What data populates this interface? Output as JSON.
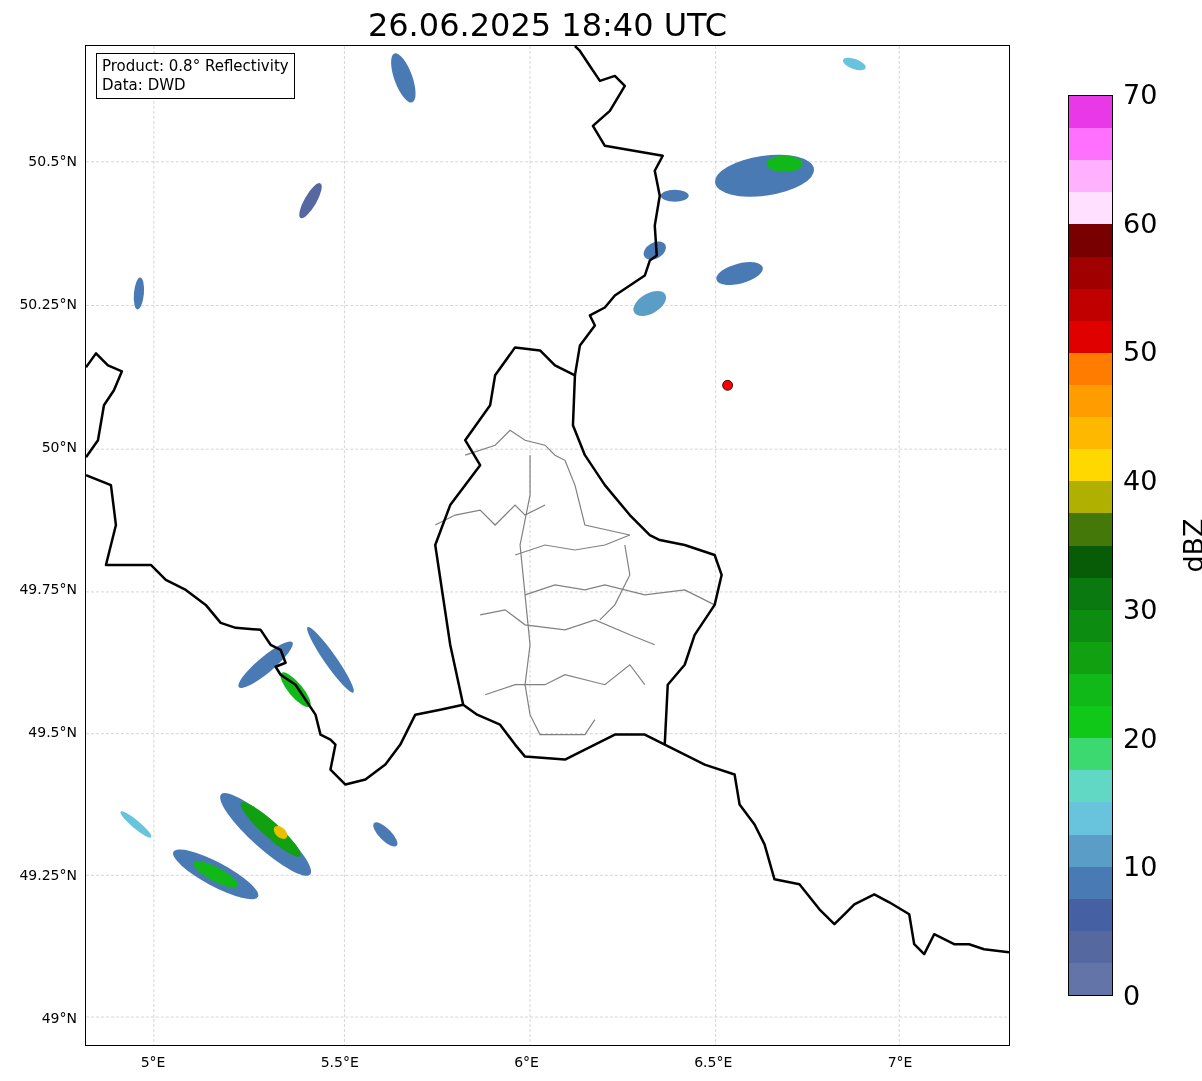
{
  "title": "26.06.2025 18:40 UTC",
  "legend": [
    "Product: 0.8° Reflectivity",
    "Data: DWD"
  ],
  "map": {
    "yticks": [
      "50.5°N",
      "50.25°N",
      "50°N",
      "49.75°N",
      "49.5°N",
      "49.25°N",
      "49°N"
    ],
    "xticks": [
      "5°E",
      "5.5°E",
      "6°E",
      "6.5°E",
      "7°E"
    ]
  },
  "colorbar": {
    "label": "dBZ",
    "ticks": [
      "70",
      "60",
      "50",
      "40",
      "30",
      "20",
      "10",
      "0"
    ],
    "bands": [
      {
        "color": "#e838e8"
      },
      {
        "color": "#ff70ff"
      },
      {
        "color": "#ffb0ff"
      },
      {
        "color": "#ffe0ff"
      },
      {
        "color": "#780000"
      },
      {
        "color": "#a00000"
      },
      {
        "color": "#c00000"
      },
      {
        "color": "#e00000"
      },
      {
        "color": "#ff7c00"
      },
      {
        "color": "#ff9c00"
      },
      {
        "color": "#ffb800"
      },
      {
        "color": "#ffd800"
      },
      {
        "color": "#b0b000"
      },
      {
        "color": "#447808"
      },
      {
        "color": "#085c08"
      },
      {
        "color": "#0a7a10"
      },
      {
        "color": "#0c8c10"
      },
      {
        "color": "#10a010"
      },
      {
        "color": "#10b818"
      },
      {
        "color": "#10c818"
      },
      {
        "color": "#3cd870"
      },
      {
        "color": "#60d8c4"
      },
      {
        "color": "#68c4dc"
      },
      {
        "color": "#5a9ec8"
      },
      {
        "color": "#4a7ab4"
      },
      {
        "color": "#4660a4"
      },
      {
        "color": "#5568a0"
      },
      {
        "color": "#6374a8"
      }
    ]
  }
}
